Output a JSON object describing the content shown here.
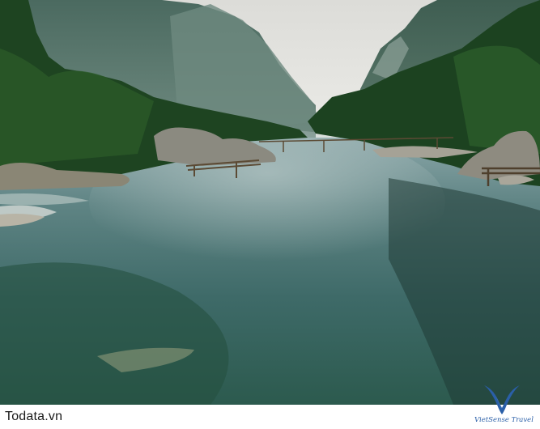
{
  "scene": {
    "subject": "mountain river with rocks and bamboo bridges"
  },
  "footer": {
    "site_label": "Todata.vn"
  },
  "watermark": {
    "brand": "VietSense Travel",
    "icon": "v-swoosh-logo-icon"
  },
  "colors": {
    "water": "#3f6e6c",
    "forest": "#1f4a22",
    "sky": "#e6e6e2",
    "logo_blue": "#2a5fa8"
  }
}
